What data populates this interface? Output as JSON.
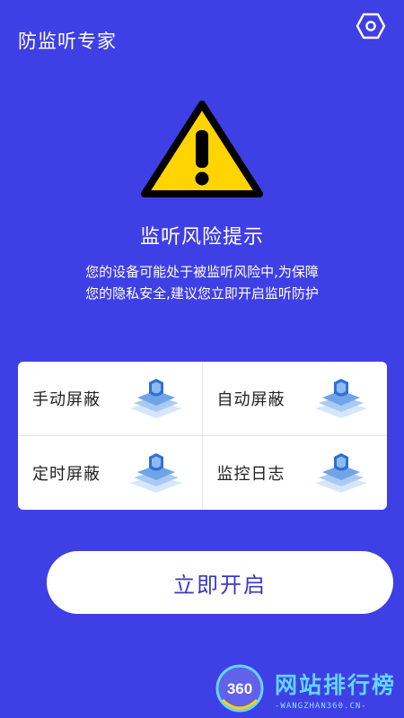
{
  "app": {
    "title": "防监听专家",
    "settings_icon": "settings-hexagon-icon"
  },
  "warning": {
    "icon": "warning-triangle-icon",
    "title": "监听风险提示",
    "description_lines": [
      "您的设备可能处于被监听风险中,为保障",
      "您的隐私安全,建议您立即开启监听防护"
    ]
  },
  "features": [
    {
      "label": "手动屏蔽",
      "icon": "shield-cube-icon"
    },
    {
      "label": "自动屏蔽",
      "icon": "shield-cube-icon"
    },
    {
      "label": "定时屏蔽",
      "icon": "shield-cube-icon"
    },
    {
      "label": "监控日志",
      "icon": "shield-cube-icon"
    }
  ],
  "action": {
    "start_label": "立即开启"
  },
  "watermark": {
    "badge": "360",
    "text": "网站排行榜",
    "subtext": "-WANGZHAN360.CN-"
  },
  "colors": {
    "background": "#3F3FE6",
    "warning_yellow": "#FFD400",
    "button_text": "#3A3AB8"
  }
}
